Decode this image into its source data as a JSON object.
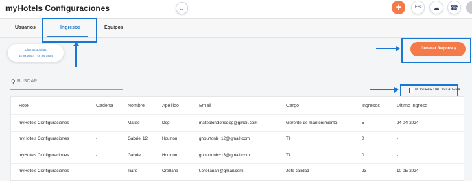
{
  "app": {
    "title": "myHotels Configuraciones"
  },
  "header": {
    "collapse_icon": "chevron-down-icon",
    "add_label": "+",
    "lang_label": "ES",
    "cloud_icon": "cloud-icon",
    "support_icon": "headset-icon",
    "user_icon": "user-avatar-icon"
  },
  "tabs": [
    {
      "label": "Usuarios"
    },
    {
      "label": "Ingresos"
    },
    {
      "label": "Equipos"
    }
  ],
  "date_filter": {
    "label": "Ultimos 30 días",
    "range": "15-04-2024 - 15-05-2024"
  },
  "generate_button": {
    "label": "Generar Reporte ⭳"
  },
  "search": {
    "placeholder": "BUSCAR",
    "icon": "search-icon"
  },
  "chain_checkbox": {
    "label": "MOSTRAR DATOS CADENA",
    "checked": false
  },
  "table": {
    "headers": [
      "Hotel",
      "Cadena",
      "Nombre",
      "Apellido",
      "Email",
      "Cargo",
      "Ingresos",
      "Ultimo Ingreso"
    ],
    "rows": [
      [
        "myHotels Configuraciones",
        "-",
        "Mateo",
        "Dog",
        "mateolondonodog@gmail.com",
        "Gerente de mantenimiento",
        "5",
        "24-04-2024"
      ],
      [
        "myHotels Configuraciones",
        "-",
        "Gabriel 12",
        "Hourton",
        "ghourtonb+12@gmail.com",
        "TI",
        "0",
        "-"
      ],
      [
        "myHotels Configuraciones",
        "-",
        "Gabriel",
        "Hourton",
        "ghourtonb+13@gmail.com",
        "TI",
        "0",
        "-"
      ],
      [
        "myHotels Configuraciones",
        "-",
        "Tiare",
        "Orellana",
        "t.orellanan@gmail.com",
        "Jefe calidad",
        "23",
        "10-05-2024"
      ]
    ]
  },
  "colors": {
    "accent": "#f47a4a",
    "primary": "#2a7cc7",
    "annotation": "#1976d2"
  }
}
